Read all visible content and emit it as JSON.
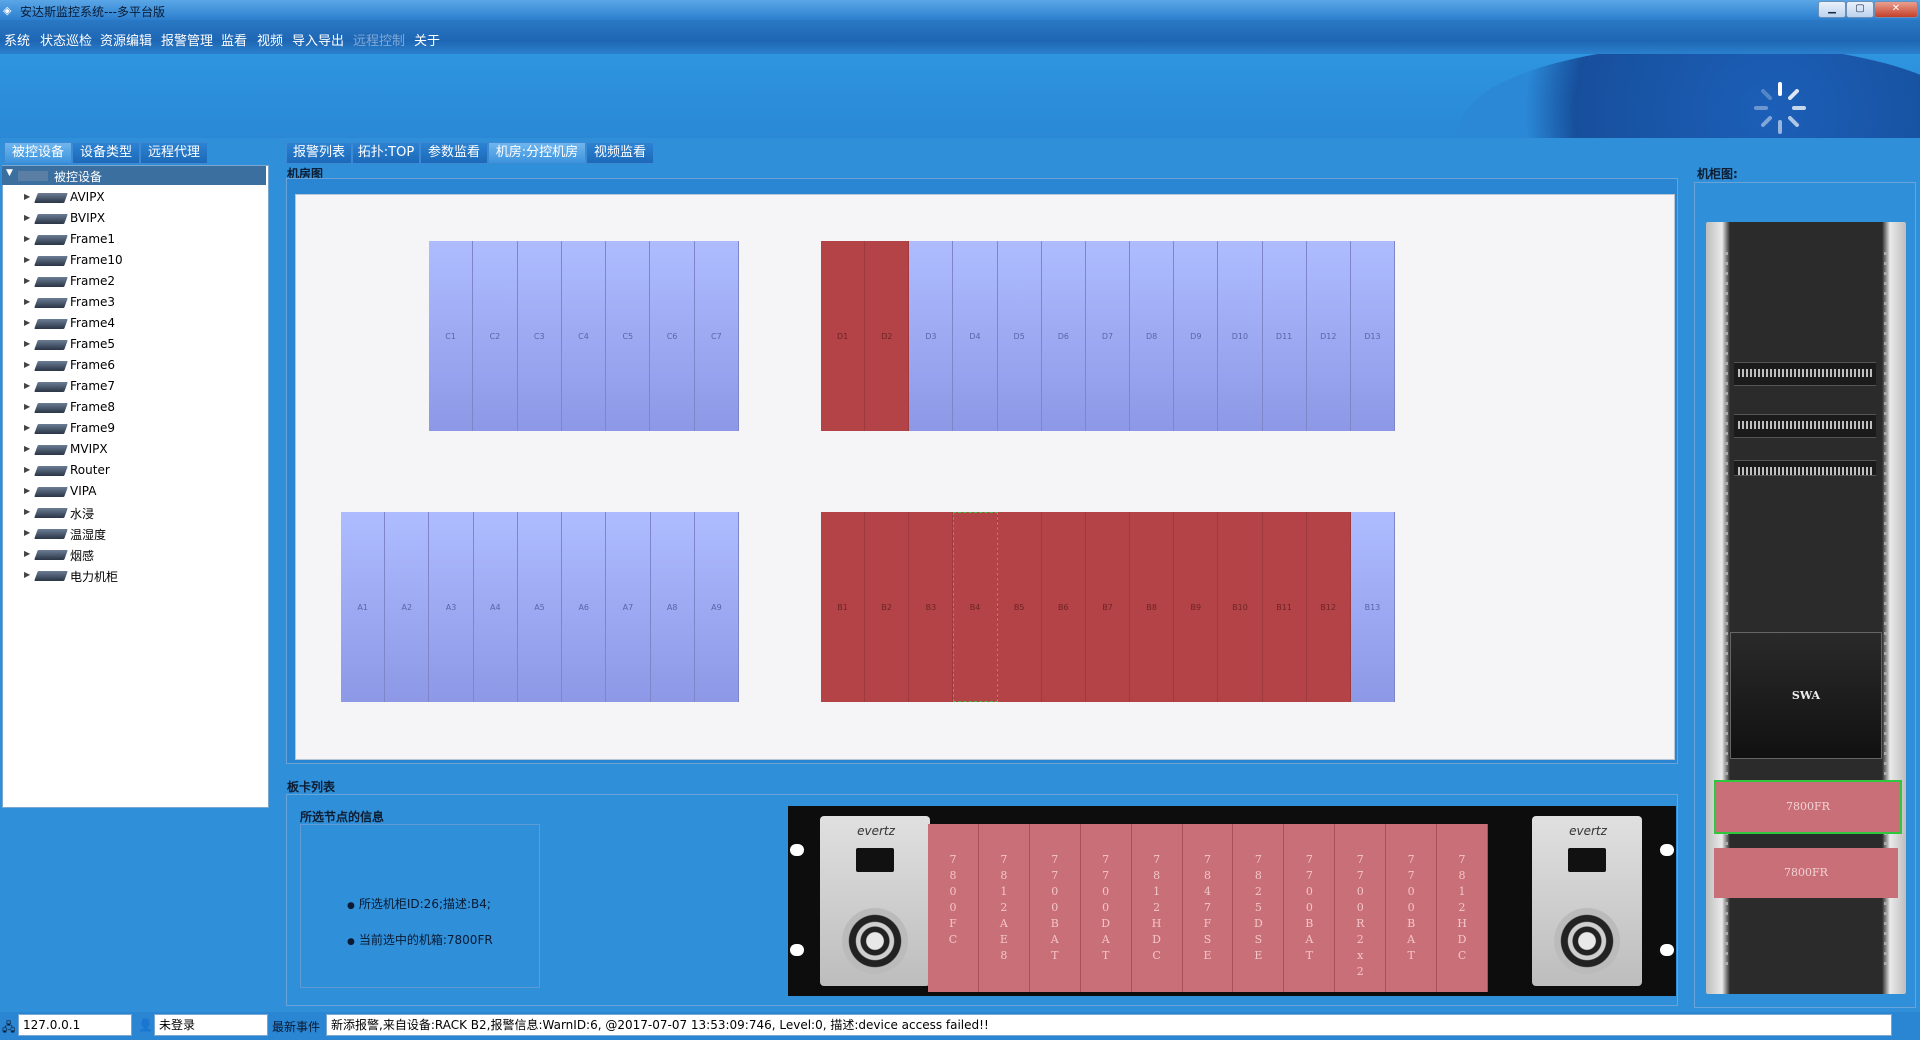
{
  "window": {
    "title": "安达斯监控系统---多平台版",
    "controls": [
      "minimize-icon",
      "maximize-icon",
      "close-icon"
    ]
  },
  "menu": {
    "items": [
      {
        "label": "系统",
        "enabled": true
      },
      {
        "label": "状态巡检",
        "enabled": true
      },
      {
        "label": "资源编辑",
        "enabled": true
      },
      {
        "label": "报警管理",
        "enabled": true
      },
      {
        "label": "监看",
        "enabled": true
      },
      {
        "label": "视频",
        "enabled": true
      },
      {
        "label": "导入导出",
        "enabled": true
      },
      {
        "label": "远程控制",
        "enabled": false
      },
      {
        "label": "关于",
        "enabled": true
      }
    ]
  },
  "left_tabs": [
    {
      "label": "被控设备",
      "active": true
    },
    {
      "label": "设备类型",
      "active": false
    },
    {
      "label": "远程代理",
      "active": false
    }
  ],
  "tree": {
    "root": "被控设备",
    "items": [
      "AVIPX",
      "BVIPX",
      "Frame1",
      "Frame10",
      "Frame2",
      "Frame3",
      "Frame4",
      "Frame5",
      "Frame6",
      "Frame7",
      "Frame8",
      "Frame9",
      "MVIPX",
      "Router",
      "VIPA",
      "水浸",
      "温湿度",
      "烟感",
      "电力机柜"
    ]
  },
  "main_tabs": [
    {
      "label": "报警列表",
      "active": false
    },
    {
      "label": "拓扑:TOP",
      "active": false
    },
    {
      "label": "参数监看",
      "active": false
    },
    {
      "label": "机房:分控机房",
      "active": true
    },
    {
      "label": "视频监看",
      "active": false
    }
  ],
  "room": {
    "label": "机房图",
    "rows": [
      {
        "cabinets": [
          "C1",
          "C2",
          "C3",
          "C4",
          "C5",
          "C6",
          "C7"
        ],
        "alarm": [
          false,
          false,
          false,
          false,
          false,
          false,
          false
        ]
      },
      {
        "cabinets": [
          "D1",
          "D2",
          "D3",
          "D4",
          "D5",
          "D6",
          "D7",
          "D8",
          "D9",
          "D10",
          "D11",
          "D12",
          "D13"
        ],
        "alarm": [
          true,
          true,
          false,
          false,
          false,
          false,
          false,
          false,
          false,
          false,
          false,
          false,
          false
        ]
      },
      {
        "cabinets": [
          "A1",
          "A2",
          "A3",
          "A4",
          "A5",
          "A6",
          "A7",
          "A8",
          "A9"
        ],
        "alarm": [
          false,
          false,
          false,
          false,
          false,
          false,
          false,
          false,
          false
        ]
      },
      {
        "cabinets": [
          "B1",
          "B2",
          "B3",
          "B4",
          "B5",
          "B6",
          "B7",
          "B8",
          "B9",
          "B10",
          "B11",
          "B12",
          "B13"
        ],
        "alarm": [
          true,
          true,
          true,
          true,
          true,
          true,
          true,
          true,
          true,
          true,
          true,
          true,
          false
        ],
        "selected": "B4"
      }
    ]
  },
  "card_list": {
    "label": "板卡列表",
    "info_title": "所选节点的信息",
    "info_lines": [
      "所选机柜ID:26;描述:B4;",
      "当前选中的机箱:7800FR"
    ],
    "brand": "evertz",
    "cards": [
      "7800FC",
      "7812AE8",
      "7700BAT",
      "7700DAT",
      "7812HDC",
      "7847FSE",
      "7825DSE",
      "7700BAT",
      "7700R2x2",
      "7700BAT",
      "7812HDC"
    ]
  },
  "rack": {
    "label": "机柜图:",
    "devices": [
      "SWA"
    ],
    "frames": [
      {
        "label": "7800FR",
        "selected": true
      },
      {
        "label": "7800FR",
        "selected": false
      }
    ]
  },
  "status": {
    "ip": "127.0.0.1",
    "login": "未登录",
    "event_label": "最新事件",
    "event_text": "新添报警,来自设备:RACK B2,报警信息:WarnID:6, @2017-07-07 13:53:09:746, Level:0, 描述:device access failed!!"
  },
  "colors": {
    "cabinet_normal": "#9aa6f0",
    "cabinet_alarm": "#b34346",
    "card_alarm": "#c86f77",
    "selected_outline": "#2ec73e",
    "window_bg": "#2f8fd8"
  }
}
